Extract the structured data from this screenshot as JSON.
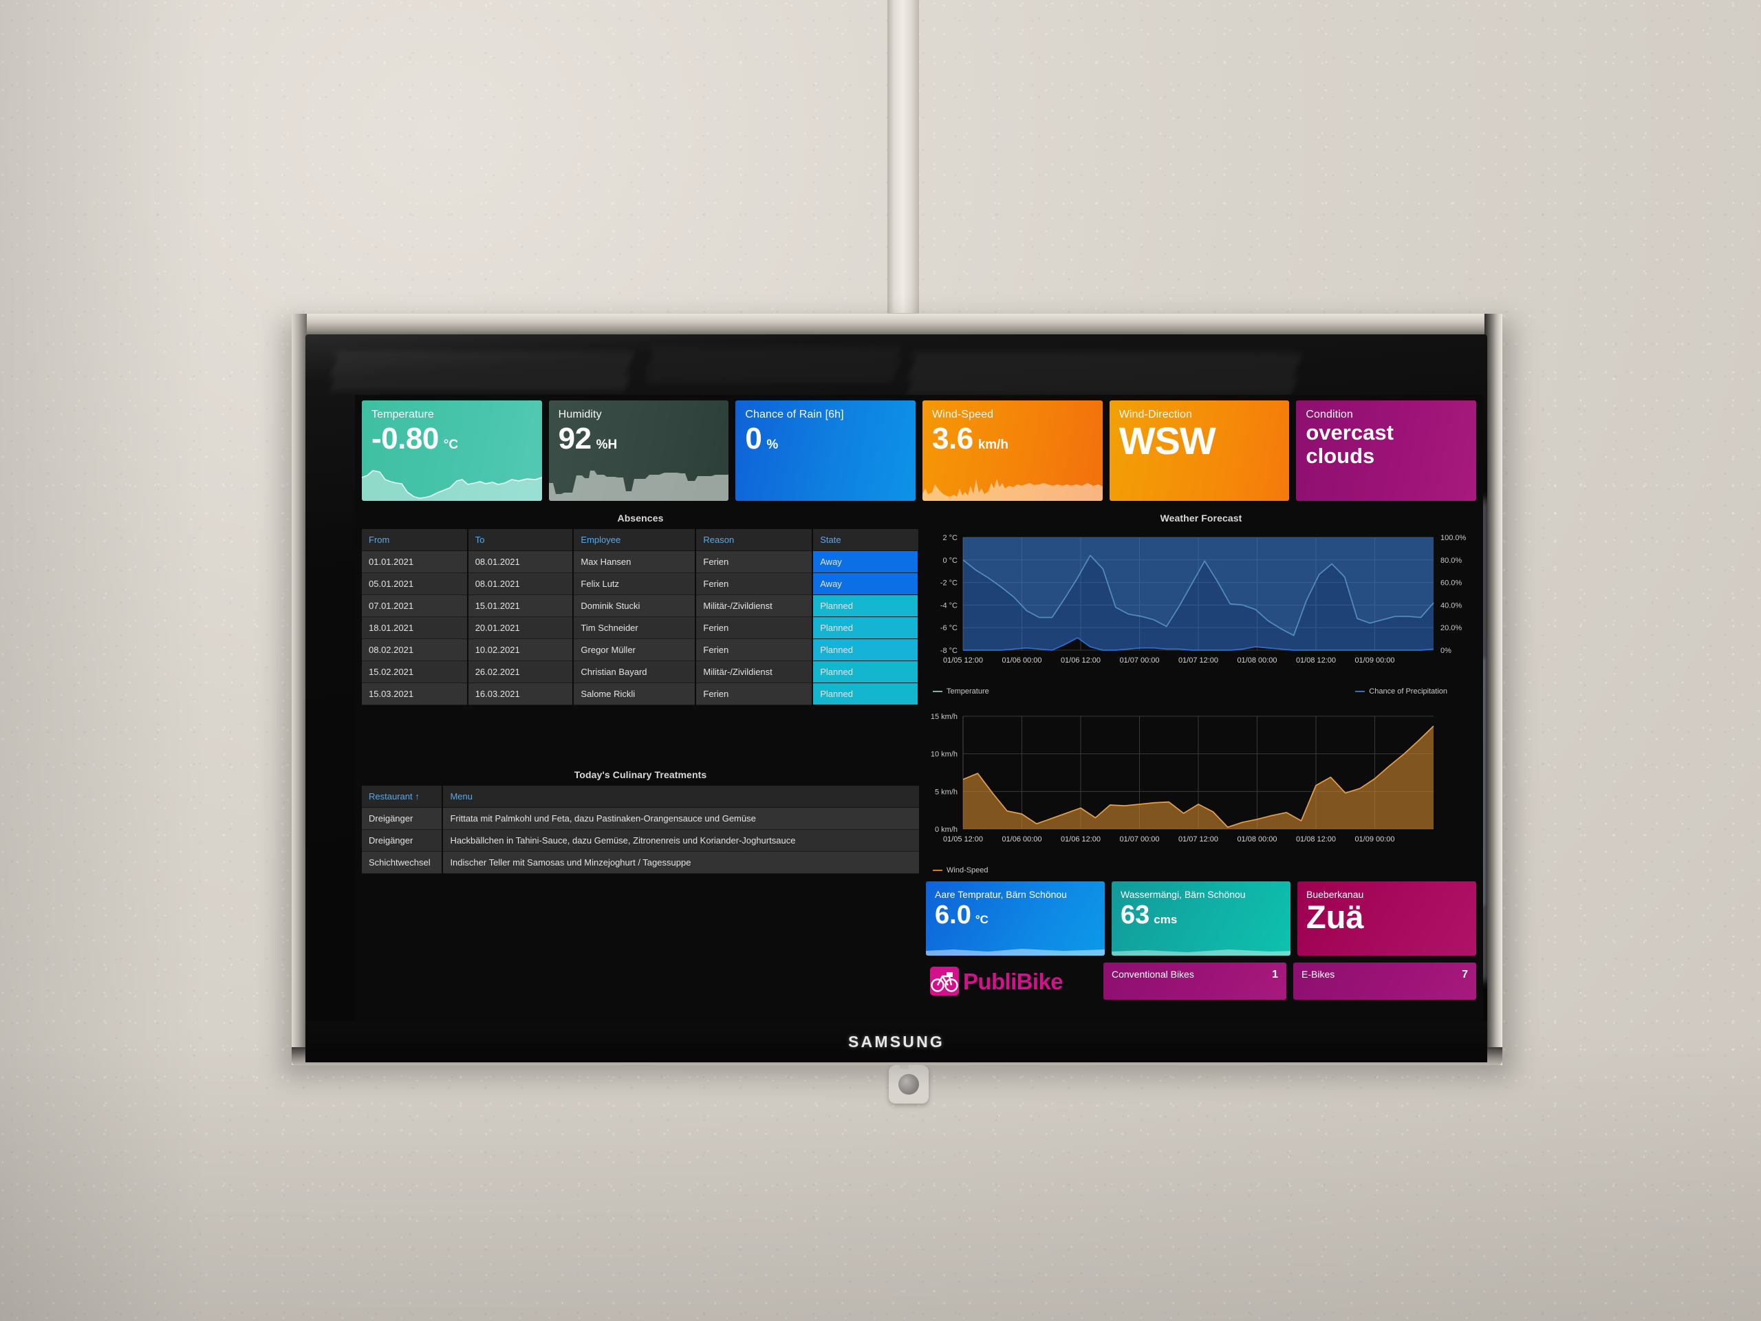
{
  "device": {
    "brand": "SAMSUNG"
  },
  "kpis": [
    {
      "name": "temperature",
      "title": "Temperature",
      "value": "-0.80",
      "unit": "°C",
      "color": "#47c4ab"
    },
    {
      "name": "humidity",
      "title": "Humidity",
      "value": "92",
      "unit": "%H",
      "color": "#33463f"
    },
    {
      "name": "chance-of-rain",
      "title": "Chance of Rain [6h]",
      "value": "0",
      "unit": "%",
      "color": "#0f7fe0"
    },
    {
      "name": "wind-speed",
      "title": "Wind-Speed",
      "value": "3.6",
      "unit": "km/h",
      "color": "#f58309"
    },
    {
      "name": "wind-direction",
      "title": "Wind-Direction",
      "value": "WSW",
      "unit": "",
      "color": "#f58b08"
    },
    {
      "name": "condition",
      "title": "Condition",
      "value": "overcast clouds",
      "unit": "",
      "color": "#9c1276"
    }
  ],
  "absences": {
    "title": "Absences",
    "columns": [
      "From",
      "To",
      "Employee",
      "Reason",
      "State"
    ],
    "rows": [
      {
        "from": "01.01.2021",
        "to": "08.01.2021",
        "employee": "Max Hansen",
        "reason": "Ferien",
        "state": "Away"
      },
      {
        "from": "05.01.2021",
        "to": "08.01.2021",
        "employee": "Felix Lutz",
        "reason": "Ferien",
        "state": "Away"
      },
      {
        "from": "07.01.2021",
        "to": "15.01.2021",
        "employee": "Dominik Stucki",
        "reason": "Militär-/Zivildienst",
        "state": "Planned"
      },
      {
        "from": "18.01.2021",
        "to": "20.01.2021",
        "employee": "Tim Schneider",
        "reason": "Ferien",
        "state": "Planned"
      },
      {
        "from": "08.02.2021",
        "to": "10.02.2021",
        "employee": "Gregor Müller",
        "reason": "Ferien",
        "state": "Planned"
      },
      {
        "from": "15.02.2021",
        "to": "26.02.2021",
        "employee": "Christian Bayard",
        "reason": "Militär-/Zivildienst",
        "state": "Planned"
      },
      {
        "from": "15.03.2021",
        "to": "16.03.2021",
        "employee": "Salome Rickli",
        "reason": "Ferien",
        "state": "Planned"
      }
    ]
  },
  "culinary": {
    "title": "Today's Culinary Treatments",
    "columns": [
      "Restaurant ↑",
      "Menu"
    ],
    "rows": [
      {
        "restaurant": "Dreigänger",
        "menu": "Frittata mit Palmkohl und Feta, dazu Pastinaken-Orangensauce und Gemüse"
      },
      {
        "restaurant": "Dreigänger",
        "menu": "Hackbällchen in Tahini-Sauce, dazu Gemüse, Zitronenreis und Koriander-Joghurtsauce"
      },
      {
        "restaurant": "Schichtwechsel",
        "menu": "Indischer Teller mit Samosas und Minzejoghurt / Tagessuppe"
      }
    ]
  },
  "bottom_cards": [
    {
      "name": "aare-temperature",
      "title": "Aare Tempratur, Bärn Schönou",
      "value": "6.0",
      "unit": "°C"
    },
    {
      "name": "water-flow",
      "title": "Wassermängi, Bärn Schönou",
      "value": "63",
      "unit": "cms"
    },
    {
      "name": "bueberkanau",
      "title": "Bueberkanau",
      "value": "Zuä",
      "unit": ""
    }
  ],
  "publibike": {
    "logo_text": "PubliBike",
    "cards": [
      {
        "name": "conventional-bikes",
        "label": "Conventional Bikes",
        "count": "1"
      },
      {
        "name": "e-bikes",
        "label": "E-Bikes",
        "count": "7"
      }
    ]
  },
  "chart_data": [
    {
      "type": "line",
      "name": "weather-forecast",
      "title": "Weather Forecast",
      "xlabel": "",
      "ylabel": "°C",
      "y2label": "%",
      "ylim": [
        -8,
        2
      ],
      "y2lim": [
        0,
        100
      ],
      "grid": true,
      "legend_position": "bottom",
      "yticks": [
        "2 °C",
        "0 °C",
        "-2 °C",
        "-4 °C",
        "-6 °C",
        "-8 °C"
      ],
      "y2ticks": [
        "100.0%",
        "80.0%",
        "60.0%",
        "40.0%",
        "20.0%",
        "0%"
      ],
      "xticks": [
        "01/05 12:00",
        "01/06 00:00",
        "01/06 12:00",
        "01/07 00:00",
        "01/07 12:00",
        "01/08 00:00",
        "01/08 12:00",
        "01/09 00:00"
      ],
      "series": [
        {
          "name": "Temperature",
          "color": "#7fb3a6",
          "axis": "left",
          "values": [
            0.0,
            -0.9,
            -1.6,
            -2.4,
            -3.3,
            -4.5,
            -5.1,
            -5.1,
            -3.4,
            -1.6,
            0.4,
            -0.8,
            -4.2,
            -4.8,
            -5.0,
            -5.3,
            -5.9,
            -4.1,
            -2.1,
            -0.1,
            -1.9,
            -3.9,
            -4.0,
            -4.4,
            -5.4,
            -6.1,
            -6.7,
            -3.6,
            -1.3,
            -0.35,
            -1.5,
            -5.2,
            -5.6,
            -5.3,
            -5.0,
            -5.0,
            -5.1,
            -3.8
          ]
        },
        {
          "name": "Chance of Precipitation",
          "color": "#2f6fd0",
          "axis": "right",
          "values": [
            0,
            0,
            0,
            0,
            1,
            2,
            1,
            0,
            5,
            11,
            3,
            0,
            0,
            1,
            2,
            2,
            1,
            1,
            0,
            0,
            0,
            0,
            1,
            3,
            2,
            1,
            0,
            0,
            0,
            0,
            0,
            0,
            0,
            0,
            0,
            0,
            0,
            1
          ]
        }
      ]
    },
    {
      "type": "area",
      "name": "wind-speed-chart",
      "title": "",
      "xlabel": "",
      "ylabel": "km/h",
      "ylim": [
        0,
        15
      ],
      "grid": true,
      "legend_position": "bottom",
      "yticks": [
        "15 km/h",
        "10 km/h",
        "5 km/h",
        "0 km/h"
      ],
      "xticks": [
        "01/05 12:00",
        "01/06 00:00",
        "01/06 12:00",
        "01/07 00:00",
        "01/07 12:00",
        "01/08 00:00",
        "01/08 12:00",
        "01/09 00:00"
      ],
      "series": [
        {
          "name": "Wind-Speed",
          "color": "#c8822c",
          "values": [
            6.6,
            7.4,
            4.8,
            2.4,
            2.0,
            0.7,
            1.4,
            2.1,
            2.8,
            1.5,
            3.2,
            3.1,
            3.3,
            3.5,
            3.6,
            2.1,
            3.3,
            2.3,
            0.25,
            0.9,
            1.3,
            1.8,
            2.2,
            1.1,
            5.8,
            6.9,
            4.8,
            5.4,
            6.7,
            8.4,
            10.0,
            11.8,
            13.7
          ]
        }
      ]
    },
    {
      "type": "area",
      "name": "temperature-sparkline",
      "title": "Temperature",
      "values": [
        0.55,
        0.6,
        0.72,
        0.68,
        0.5,
        0.45,
        0.42,
        0.4,
        0.2,
        0.08,
        0.05,
        0.07,
        0.1,
        0.18,
        0.22,
        0.3,
        0.45,
        0.5,
        0.38,
        0.42,
        0.44,
        0.4,
        0.43,
        0.38,
        0.42,
        0.5,
        0.46,
        0.52,
        0.5
      ],
      "color": "#a9e3d5"
    },
    {
      "type": "area",
      "name": "humidity-sparkline",
      "title": "Humidity",
      "values": [
        0.25,
        0.12,
        0.15,
        0.2,
        0.55,
        0.6,
        0.52,
        0.78,
        0.6,
        0.62,
        0.6,
        0.58,
        0.2,
        0.45,
        0.5,
        0.6,
        0.65,
        0.68,
        0.7,
        0.68,
        0.55,
        0.52,
        0.62,
        0.6,
        0.65,
        0.62,
        0.7,
        0.6
      ],
      "color": "#b8c4bd"
    },
    {
      "type": "area",
      "name": "wind-speed-sparkline",
      "title": "Wind-Speed",
      "values": [
        0.18,
        0.3,
        0.12,
        0.1,
        0.35,
        0.22,
        0.1,
        0.08,
        0.12,
        0.4,
        0.25,
        0.18,
        0.3,
        0.55,
        0.35,
        0.6,
        0.4,
        0.28,
        0.35,
        0.42,
        0.5,
        0.45,
        0.38,
        0.42,
        0.3,
        0.25,
        0.35,
        0.4,
        0.3,
        0.55,
        0.85
      ],
      "color": "#fbd29a"
    }
  ]
}
